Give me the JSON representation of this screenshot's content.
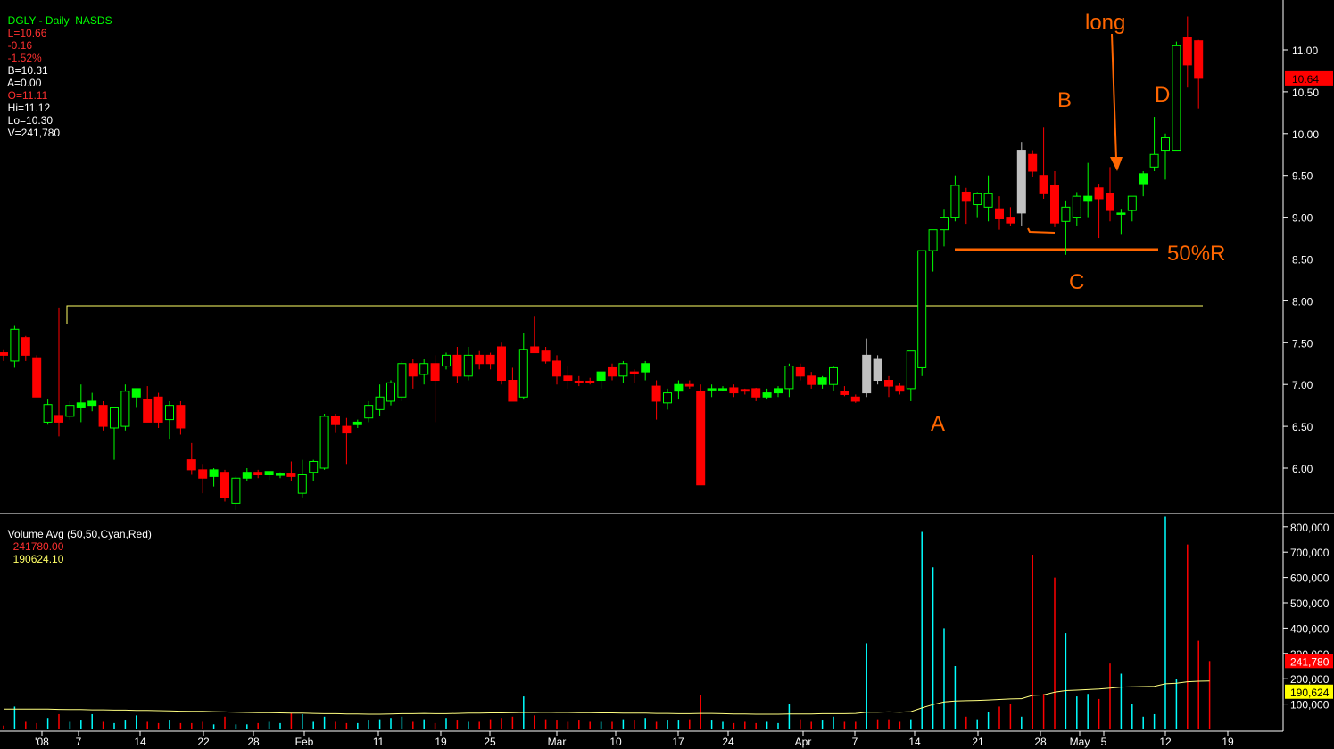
{
  "header": {
    "symbol": "DGLY - Daily  NASDS",
    "last": "L=10.66",
    "change": "-0.16",
    "change_pct": "-1.52%",
    "bid": "B=10.31",
    "ask": "A=0.00",
    "open": "O=11.11",
    "high": "Hi=11.12",
    "low": "Lo=10.30",
    "volume": "V=241,780"
  },
  "volume_header": {
    "label": "Volume Avg (50,50,Cyan,Red)",
    "value1": "241780.00",
    "value2": "190624.10"
  },
  "colors": {
    "up": "#00ff00",
    "down": "#ff0000",
    "neutral": "#c0c0c0",
    "vol_up": "#00ffff",
    "vol_down": "#ff0000",
    "vol_avg": "#ffff80",
    "resistance": "#ffff66",
    "annotation": "#ff6600",
    "axis_text": "#ffffff"
  },
  "chart_data": [
    {
      "type": "candlestick",
      "title": "DGLY - Daily",
      "ylim": [
        5.5,
        11.5
      ],
      "y_ticks": [
        "6.00",
        "6.50",
        "7.00",
        "7.50",
        "8.00",
        "8.50",
        "9.00",
        "9.50",
        "10.00",
        "10.50",
        "11.00"
      ],
      "x_tick_labels": [
        "'08",
        "7",
        "14",
        "22",
        "28",
        "Feb",
        "11",
        "19",
        "25",
        "Mar",
        "10",
        "17",
        "24",
        "Apr",
        "7",
        "14",
        "21",
        "28",
        "May",
        "5",
        "12",
        "19"
      ],
      "last_price_label": "10.64",
      "resistance_level": 7.92,
      "retracement_level": 8.6,
      "annotations": [
        "A",
        "B",
        "C",
        "D",
        "long",
        "50%R"
      ],
      "candles": [
        {
          "o": 7.38,
          "h": 7.42,
          "l": 7.28,
          "c": 7.35
        },
        {
          "o": 7.28,
          "h": 7.7,
          "l": 7.2,
          "c": 7.66
        },
        {
          "o": 7.56,
          "h": 7.58,
          "l": 7.28,
          "c": 7.35
        },
        {
          "o": 7.32,
          "h": 7.35,
          "l": 6.85,
          "c": 6.85
        },
        {
          "o": 6.55,
          "h": 6.82,
          "l": 6.52,
          "c": 6.76
        },
        {
          "o": 6.63,
          "h": 7.92,
          "l": 6.38,
          "c": 6.55
        },
        {
          "o": 6.62,
          "h": 6.8,
          "l": 6.58,
          "c": 6.75
        },
        {
          "o": 6.72,
          "h": 7.0,
          "l": 6.55,
          "c": 6.78
        },
        {
          "o": 6.75,
          "h": 6.9,
          "l": 6.68,
          "c": 6.8
        },
        {
          "o": 6.75,
          "h": 6.8,
          "l": 6.45,
          "c": 6.5
        },
        {
          "o": 6.48,
          "h": 6.72,
          "l": 6.1,
          "c": 6.72
        },
        {
          "o": 6.5,
          "h": 7.0,
          "l": 6.45,
          "c": 6.92
        },
        {
          "o": 6.85,
          "h": 6.95,
          "l": 6.72,
          "c": 6.95
        },
        {
          "o": 6.82,
          "h": 6.98,
          "l": 6.55,
          "c": 6.55
        },
        {
          "o": 6.85,
          "h": 6.9,
          "l": 6.48,
          "c": 6.55
        },
        {
          "o": 6.58,
          "h": 6.8,
          "l": 6.35,
          "c": 6.75
        },
        {
          "o": 6.75,
          "h": 6.8,
          "l": 6.4,
          "c": 6.48
        },
        {
          "o": 6.1,
          "h": 6.3,
          "l": 5.92,
          "c": 5.98
        },
        {
          "o": 5.98,
          "h": 6.05,
          "l": 5.7,
          "c": 5.88
        },
        {
          "o": 5.9,
          "h": 6.0,
          "l": 5.78,
          "c": 5.98
        },
        {
          "o": 5.95,
          "h": 5.98,
          "l": 5.6,
          "c": 5.65
        },
        {
          "o": 5.58,
          "h": 5.9,
          "l": 5.5,
          "c": 5.88
        },
        {
          "o": 5.88,
          "h": 6.0,
          "l": 5.85,
          "c": 5.95
        },
        {
          "o": 5.95,
          "h": 5.98,
          "l": 5.88,
          "c": 5.92
        },
        {
          "o": 5.92,
          "h": 5.95,
          "l": 5.86,
          "c": 5.96
        },
        {
          "o": 5.92,
          "h": 5.95,
          "l": 5.88,
          "c": 5.93
        },
        {
          "o": 5.93,
          "h": 6.08,
          "l": 5.85,
          "c": 5.9
        },
        {
          "o": 5.7,
          "h": 6.1,
          "l": 5.65,
          "c": 5.92
        },
        {
          "o": 5.95,
          "h": 6.1,
          "l": 5.85,
          "c": 6.08
        },
        {
          "o": 6.0,
          "h": 6.65,
          "l": 5.98,
          "c": 6.62
        },
        {
          "o": 6.62,
          "h": 6.65,
          "l": 6.42,
          "c": 6.52
        },
        {
          "o": 6.5,
          "h": 6.6,
          "l": 6.05,
          "c": 6.42
        },
        {
          "o": 6.52,
          "h": 6.58,
          "l": 6.48,
          "c": 6.55
        },
        {
          "o": 6.6,
          "h": 6.8,
          "l": 6.55,
          "c": 6.75
        },
        {
          "o": 6.7,
          "h": 7.0,
          "l": 6.62,
          "c": 6.85
        },
        {
          "o": 6.8,
          "h": 7.05,
          "l": 6.75,
          "c": 7.02
        },
        {
          "o": 6.85,
          "h": 7.28,
          "l": 6.8,
          "c": 7.25
        },
        {
          "o": 7.25,
          "h": 7.3,
          "l": 6.95,
          "c": 7.1
        },
        {
          "o": 7.12,
          "h": 7.3,
          "l": 7.0,
          "c": 7.25
        },
        {
          "o": 7.25,
          "h": 7.35,
          "l": 6.55,
          "c": 7.05
        },
        {
          "o": 7.22,
          "h": 7.38,
          "l": 7.18,
          "c": 7.35
        },
        {
          "o": 7.35,
          "h": 7.45,
          "l": 7.02,
          "c": 7.1
        },
        {
          "o": 7.1,
          "h": 7.45,
          "l": 7.05,
          "c": 7.35
        },
        {
          "o": 7.35,
          "h": 7.4,
          "l": 7.18,
          "c": 7.25
        },
        {
          "o": 7.35,
          "h": 7.38,
          "l": 7.18,
          "c": 7.25
        },
        {
          "o": 7.45,
          "h": 7.5,
          "l": 7.0,
          "c": 7.05
        },
        {
          "o": 7.05,
          "h": 7.2,
          "l": 6.8,
          "c": 6.8
        },
        {
          "o": 6.85,
          "h": 7.62,
          "l": 6.82,
          "c": 7.42
        },
        {
          "o": 7.45,
          "h": 7.82,
          "l": 7.38,
          "c": 7.38
        },
        {
          "o": 7.4,
          "h": 7.45,
          "l": 7.25,
          "c": 7.28
        },
        {
          "o": 7.28,
          "h": 7.35,
          "l": 7.0,
          "c": 7.1
        },
        {
          "o": 7.1,
          "h": 7.22,
          "l": 6.95,
          "c": 7.05
        },
        {
          "o": 7.04,
          "h": 7.1,
          "l": 6.98,
          "c": 7.02
        },
        {
          "o": 7.04,
          "h": 7.08,
          "l": 7.0,
          "c": 7.02
        },
        {
          "o": 7.05,
          "h": 7.15,
          "l": 6.95,
          "c": 7.15
        },
        {
          "o": 7.2,
          "h": 7.25,
          "l": 7.05,
          "c": 7.1
        },
        {
          "o": 7.1,
          "h": 7.28,
          "l": 7.02,
          "c": 7.25
        },
        {
          "o": 7.15,
          "h": 7.18,
          "l": 7.02,
          "c": 7.13
        },
        {
          "o": 7.15,
          "h": 7.28,
          "l": 7.05,
          "c": 7.25
        },
        {
          "o": 6.98,
          "h": 7.05,
          "l": 6.58,
          "c": 6.8
        },
        {
          "o": 6.78,
          "h": 6.95,
          "l": 6.7,
          "c": 6.9
        },
        {
          "o": 6.92,
          "h": 7.05,
          "l": 6.82,
          "c": 7.0
        },
        {
          "o": 7.0,
          "h": 7.05,
          "l": 6.95,
          "c": 6.98
        },
        {
          "o": 6.92,
          "h": 7.0,
          "l": 5.8,
          "c": 5.8
        },
        {
          "o": 6.95,
          "h": 7.0,
          "l": 6.85,
          "c": 6.95
        },
        {
          "o": 6.95,
          "h": 6.98,
          "l": 6.92,
          "c": 6.95
        },
        {
          "o": 6.96,
          "h": 7.0,
          "l": 6.85,
          "c": 6.9
        },
        {
          "o": 6.94,
          "h": 6.95,
          "l": 6.88,
          "c": 6.92
        },
        {
          "o": 6.95,
          "h": 6.96,
          "l": 6.8,
          "c": 6.85
        },
        {
          "o": 6.85,
          "h": 6.95,
          "l": 6.82,
          "c": 6.9
        },
        {
          "o": 6.9,
          "h": 6.98,
          "l": 6.85,
          "c": 6.95
        },
        {
          "o": 6.95,
          "h": 7.25,
          "l": 6.85,
          "c": 7.22
        },
        {
          "o": 7.2,
          "h": 7.25,
          "l": 7.05,
          "c": 7.1
        },
        {
          "o": 7.1,
          "h": 7.15,
          "l": 6.95,
          "c": 7.0
        },
        {
          "o": 7.0,
          "h": 7.1,
          "l": 6.95,
          "c": 7.08
        },
        {
          "o": 7.0,
          "h": 7.22,
          "l": 6.92,
          "c": 7.2
        },
        {
          "o": 6.92,
          "h": 6.98,
          "l": 6.86,
          "c": 6.88
        },
        {
          "o": 6.85,
          "h": 6.88,
          "l": 6.78,
          "c": 6.8
        },
        {
          "o": 6.9,
          "h": 7.55,
          "l": 6.85,
          "c": 7.35
        },
        {
          "o": 7.3,
          "h": 7.35,
          "l": 7.0,
          "c": 7.05
        },
        {
          "o": 7.05,
          "h": 7.1,
          "l": 6.85,
          "c": 6.98
        },
        {
          "o": 6.98,
          "h": 7.02,
          "l": 6.88,
          "c": 6.92
        },
        {
          "o": 6.95,
          "h": 7.05,
          "l": 6.8,
          "c": 7.4
        },
        {
          "o": 7.2,
          "h": 7.6,
          "l": 7.1,
          "c": 8.6
        },
        {
          "o": 8.6,
          "h": 8.8,
          "l": 8.35,
          "c": 8.85
        },
        {
          "o": 8.85,
          "h": 9.1,
          "l": 8.65,
          "c": 9.0
        },
        {
          "o": 9.0,
          "h": 9.5,
          "l": 8.95,
          "c": 9.38
        },
        {
          "o": 9.3,
          "h": 9.35,
          "l": 8.92,
          "c": 9.2
        },
        {
          "o": 9.15,
          "h": 9.3,
          "l": 9.0,
          "c": 9.28
        },
        {
          "o": 9.12,
          "h": 9.5,
          "l": 8.95,
          "c": 9.28
        },
        {
          "o": 9.1,
          "h": 9.25,
          "l": 8.85,
          "c": 8.98
        },
        {
          "o": 9.0,
          "h": 9.12,
          "l": 8.9,
          "c": 8.93
        },
        {
          "o": 9.05,
          "h": 9.9,
          "l": 8.9,
          "c": 9.8
        },
        {
          "o": 9.75,
          "h": 9.8,
          "l": 9.48,
          "c": 9.55
        },
        {
          "o": 9.5,
          "h": 10.08,
          "l": 9.22,
          "c": 9.28
        },
        {
          "o": 9.38,
          "h": 9.55,
          "l": 8.88,
          "c": 8.93
        },
        {
          "o": 8.95,
          "h": 9.2,
          "l": 8.55,
          "c": 9.12
        },
        {
          "o": 9.0,
          "h": 9.3,
          "l": 8.9,
          "c": 9.25
        },
        {
          "o": 9.2,
          "h": 9.65,
          "l": 9.0,
          "c": 9.25
        },
        {
          "o": 9.35,
          "h": 9.4,
          "l": 8.75,
          "c": 9.22
        },
        {
          "o": 9.28,
          "h": 9.6,
          "l": 8.95,
          "c": 9.08
        },
        {
          "o": 9.05,
          "h": 9.1,
          "l": 8.8,
          "c": 9.05
        },
        {
          "o": 9.08,
          "h": 9.25,
          "l": 8.95,
          "c": 9.25
        },
        {
          "o": 9.4,
          "h": 9.55,
          "l": 9.25,
          "c": 9.52
        },
        {
          "o": 9.6,
          "h": 10.2,
          "l": 9.55,
          "c": 9.75
        },
        {
          "o": 9.8,
          "h": 10.0,
          "l": 9.45,
          "c": 9.95
        },
        {
          "o": 9.8,
          "h": 11.1,
          "l": 9.8,
          "c": 11.05
        },
        {
          "o": 11.15,
          "h": 11.4,
          "l": 10.55,
          "c": 10.82
        },
        {
          "o": 11.11,
          "h": 11.12,
          "l": 10.3,
          "c": 10.66
        }
      ]
    },
    {
      "type": "bar",
      "title": "Volume Avg (50,50,Cyan,Red)",
      "ylim": [
        0,
        900000
      ],
      "y_ticks": [
        "100,000",
        "200,000",
        "300,000",
        "400,000",
        "500,000",
        "600,000",
        "700,000",
        "800,000"
      ],
      "last_volume_label": "241,780",
      "avg_volume_label": "190,624",
      "volumes": [
        15000,
        90000,
        30000,
        25000,
        45000,
        60000,
        30000,
        35000,
        60000,
        30000,
        25000,
        35000,
        55000,
        30000,
        25000,
        35000,
        25000,
        25000,
        30000,
        20000,
        50000,
        20000,
        20000,
        25000,
        30000,
        25000,
        65000,
        60000,
        30000,
        50000,
        30000,
        25000,
        25000,
        35000,
        40000,
        45000,
        50000,
        30000,
        40000,
        25000,
        45000,
        35000,
        30000,
        30000,
        40000,
        45000,
        50000,
        130000,
        55000,
        40000,
        35000,
        30000,
        35000,
        30000,
        30000,
        30000,
        40000,
        35000,
        45000,
        30000,
        35000,
        35000,
        40000,
        135000,
        35000,
        30000,
        25000,
        30000,
        25000,
        30000,
        25000,
        100000,
        40000,
        30000,
        35000,
        50000,
        30000,
        30000,
        340000,
        40000,
        40000,
        30000,
        40000,
        780000,
        640000,
        400000,
        250000,
        50000,
        40000,
        70000,
        90000,
        100000,
        50000,
        690000,
        140000,
        600000,
        380000,
        130000,
        140000,
        120000,
        260000,
        220000,
        100000,
        50000,
        60000,
        840000,
        200000,
        730000,
        350000,
        270000
      ],
      "avg_volume": [
        80000,
        80000,
        80000,
        80000,
        80000,
        79000,
        78000,
        78000,
        77000,
        77000,
        76000,
        76000,
        75000,
        75000,
        74000,
        73000,
        72000,
        71000,
        71000,
        70000,
        69000,
        68000,
        67000,
        66000,
        66000,
        65000,
        64000,
        64000,
        63000,
        62000,
        62000,
        61000,
        61000,
        60000,
        60000,
        61000,
        62000,
        62000,
        63000,
        62000,
        62000,
        63000,
        64000,
        64000,
        65000,
        65000,
        66000,
        67000,
        67000,
        68000,
        67000,
        67000,
        66000,
        66000,
        65000,
        65000,
        64000,
        64000,
        64000,
        63000,
        63000,
        62000,
        62000,
        63000,
        63000,
        62000,
        61000,
        61000,
        60000,
        60000,
        60000,
        61000,
        61000,
        61000,
        62000,
        62000,
        62000,
        63000,
        68000,
        68000,
        69000,
        68000,
        70000,
        85000,
        98000,
        108000,
        112000,
        113000,
        114000,
        116000,
        118000,
        120000,
        121000,
        134000,
        136000,
        147000,
        153000,
        155000,
        157000,
        159000,
        163000,
        167000,
        168000,
        169000,
        170000,
        180000,
        182000,
        188000,
        190000,
        191000
      ]
    }
  ]
}
